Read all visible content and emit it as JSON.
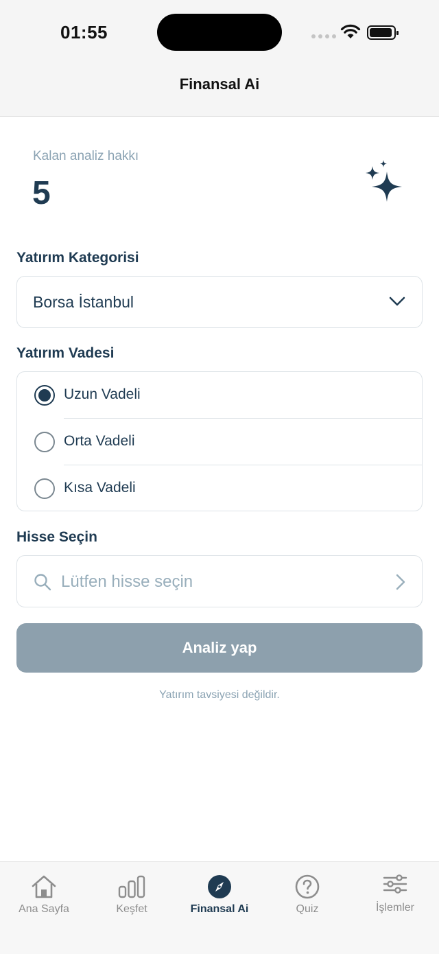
{
  "status_bar": {
    "time": "01:55"
  },
  "nav": {
    "title": "Finansal Ai"
  },
  "credits": {
    "label": "Kalan analiz hakkı",
    "value": "5",
    "icon": "sparkles-icon"
  },
  "category": {
    "title": "Yatırım Kategorisi",
    "selected": "Borsa İstanbul"
  },
  "term": {
    "title": "Yatırım Vadesi",
    "options": [
      {
        "label": "Uzun Vadeli",
        "selected": true
      },
      {
        "label": "Orta Vadeli",
        "selected": false
      },
      {
        "label": "Kısa Vadeli",
        "selected": false
      }
    ]
  },
  "stock": {
    "title": "Hisse Seçin",
    "placeholder": "Lütfen hisse seçin"
  },
  "action": {
    "button_label": "Analiz yap",
    "disclaimer": "Yatırım tavsiyesi değildir."
  },
  "colors": {
    "primary": "#1f3b52",
    "button_disabled": "#8da0ad",
    "muted": "#8ba3b3"
  },
  "tabs": [
    {
      "label": "Ana Sayfa",
      "icon": "home-icon",
      "active": false
    },
    {
      "label": "Keşfet",
      "icon": "bar-chart-icon",
      "active": false
    },
    {
      "label": "Finansal Ai",
      "icon": "compass-icon",
      "active": true
    },
    {
      "label": "Quiz",
      "icon": "question-circle-icon",
      "active": false
    },
    {
      "label": "İşlemler",
      "icon": "sliders-icon",
      "active": false
    }
  ]
}
